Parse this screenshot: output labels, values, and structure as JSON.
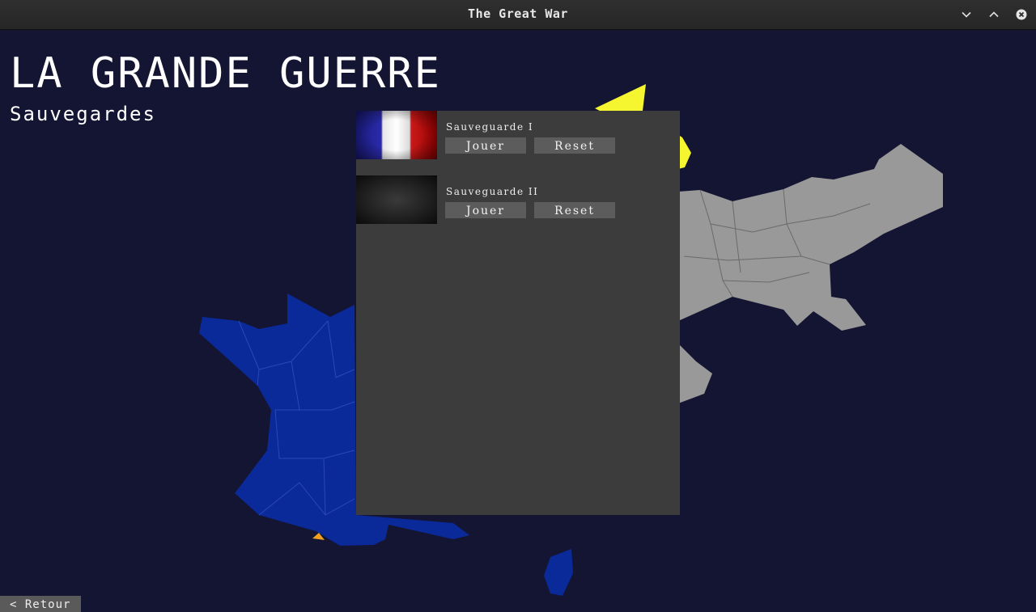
{
  "window": {
    "title": "The Great War"
  },
  "header": {
    "title": "LA GRANDE GUERRE",
    "subtitle": "Sauvegardes"
  },
  "saves": [
    {
      "name": "Sauveguarde I",
      "play_label": "Jouer",
      "reset_label": "Reset",
      "thumbnail": "french-flag"
    },
    {
      "name": "Sauveguarde II",
      "play_label": "Jouer",
      "reset_label": "Reset",
      "thumbnail": "dark-texture"
    }
  ],
  "footer": {
    "back_label": "< Retour"
  },
  "colors": {
    "background": "#141433",
    "france": "#0a2a9a",
    "germany": "#999999",
    "neutral_yellow": "#f5f530",
    "spain": "#f0a020",
    "panel": "#3c3c3c",
    "button": "#5c5c5c"
  },
  "icons": [
    "chevron-down-icon",
    "chevron-up-icon",
    "close-icon"
  ]
}
